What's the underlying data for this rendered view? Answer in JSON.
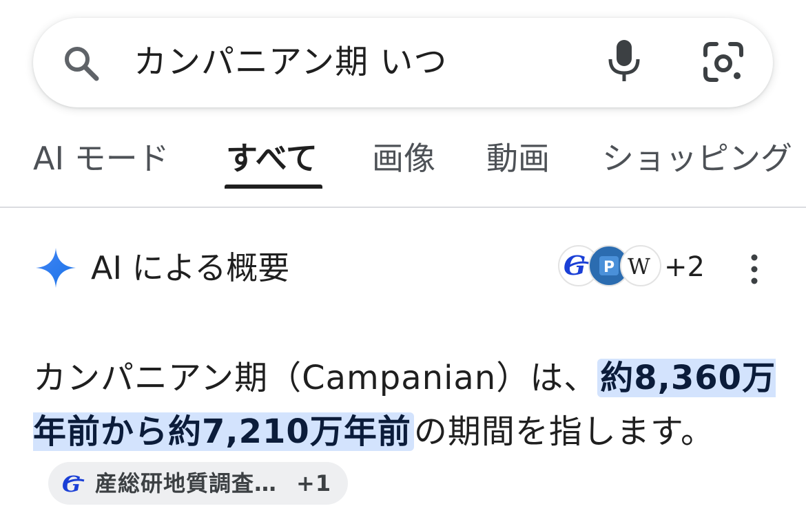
{
  "search": {
    "query": "カンパニアン期 いつ"
  },
  "tabs": [
    {
      "label": "AI モード",
      "active": false
    },
    {
      "label": "すべて",
      "active": true
    },
    {
      "label": "画像",
      "active": false
    },
    {
      "label": "動画",
      "active": false
    },
    {
      "label": "ショッピング",
      "active": false
    }
  ],
  "ai_overview": {
    "title": "AI による概要",
    "sources_more": "+2",
    "source_icons": [
      "gsj-icon",
      "p-icon",
      "wikipedia-icon"
    ],
    "answer": {
      "part1": "カンパニアン期（Campanian）は、",
      "highlight": "約8,360万年前から約7,210万年前",
      "part2": "の期間を指します。"
    },
    "citation_chip": {
      "label": "産総研地質調査…",
      "more": "+1"
    }
  },
  "colors": {
    "highlight_bg": "#d3e3fd",
    "ai_spark": "#4285f4",
    "divider": "#dadce0"
  }
}
